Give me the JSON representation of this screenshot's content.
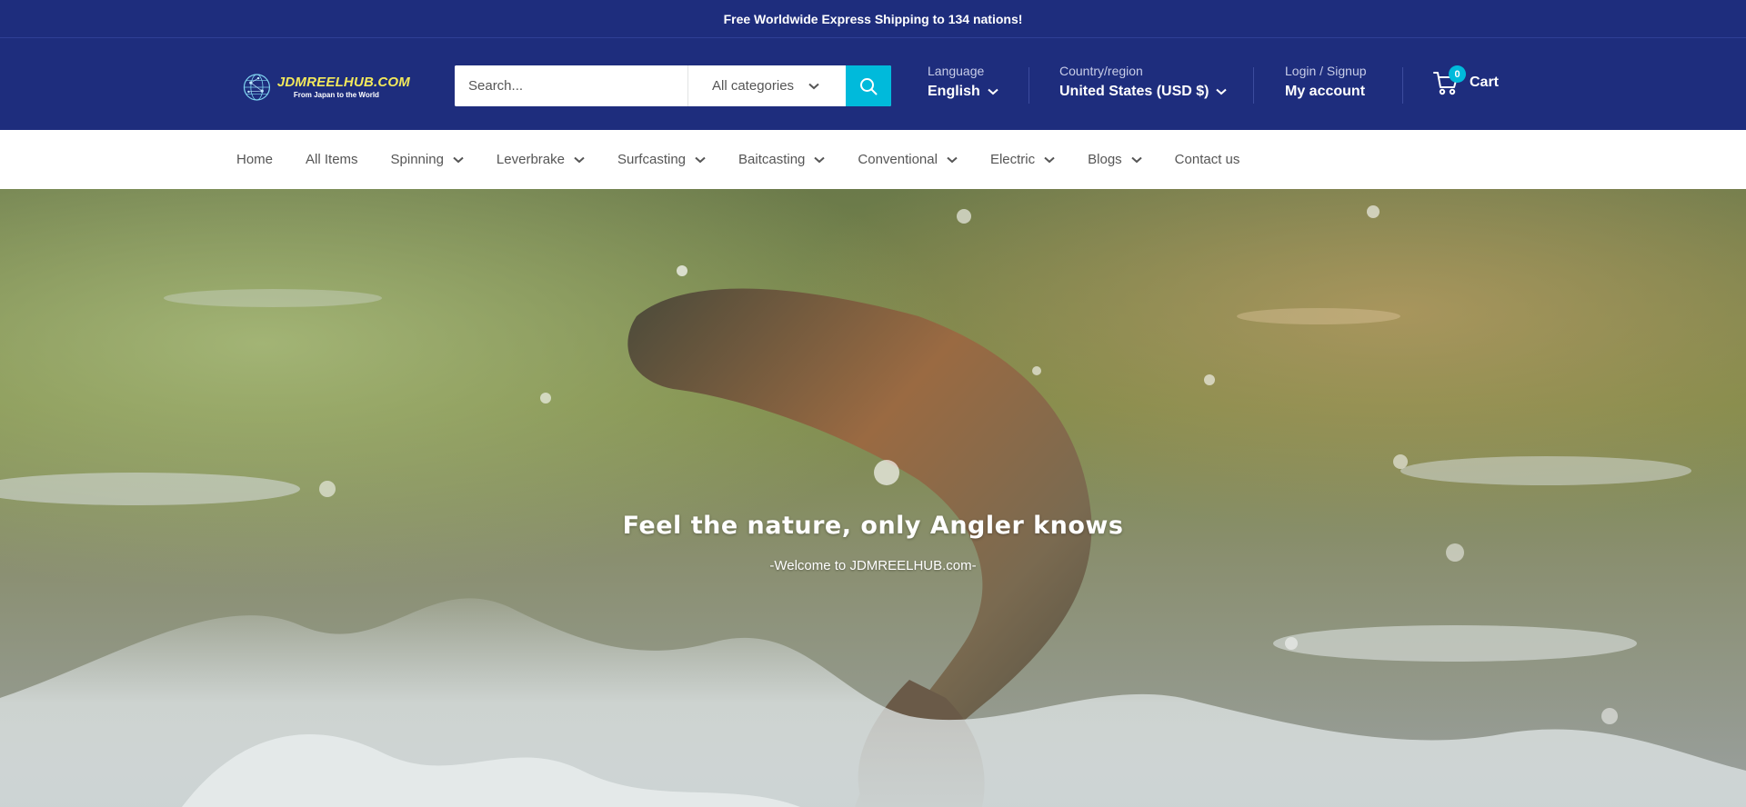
{
  "announcement": "Free Worldwide Express Shipping to 134 nations!",
  "logo": {
    "main": "JDMREELHUB.COM",
    "sub": "From Japan to the World"
  },
  "search": {
    "placeholder": "Search...",
    "category": "All categories"
  },
  "language": {
    "label": "Language",
    "value": "English"
  },
  "country": {
    "label": "Country/region",
    "value": "United States (USD $)"
  },
  "account": {
    "label": "Login / Signup",
    "value": "My account"
  },
  "cart": {
    "count": "0",
    "label": "Cart"
  },
  "nav": [
    {
      "label": "Home",
      "dropdown": false
    },
    {
      "label": "All Items",
      "dropdown": false
    },
    {
      "label": "Spinning",
      "dropdown": true
    },
    {
      "label": "Leverbrake",
      "dropdown": true
    },
    {
      "label": "Surfcasting",
      "dropdown": true
    },
    {
      "label": "Baitcasting",
      "dropdown": true
    },
    {
      "label": "Conventional",
      "dropdown": true
    },
    {
      "label": "Electric",
      "dropdown": true
    },
    {
      "label": "Blogs",
      "dropdown": true
    },
    {
      "label": "Contact us",
      "dropdown": false
    }
  ],
  "hero": {
    "title": "Feel the nature, only Angler knows",
    "subtitle": "-Welcome to JDMREELHUB.com-"
  },
  "colors": {
    "header": "#1e2d7d",
    "accent": "#00badb",
    "logo": "#f2e85c"
  }
}
